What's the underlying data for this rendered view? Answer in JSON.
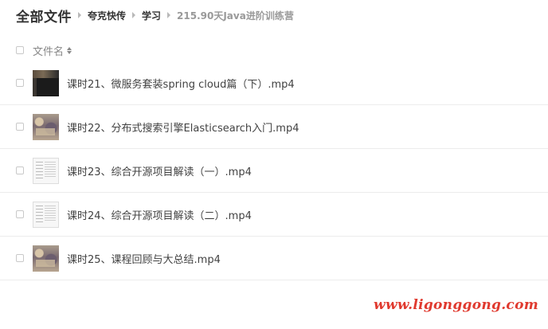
{
  "breadcrumb": {
    "root": "全部文件",
    "items": [
      "夸克快传",
      "学习",
      "215.90天Java进阶训练营"
    ]
  },
  "header": {
    "column_label": "文件名"
  },
  "files": [
    {
      "name": "课时21、微服务套装spring cloud篇（下）.mp4",
      "thumb": "video-thumbnail-dark"
    },
    {
      "name": "课时22、分布式搜索引擎Elasticsearch入门.mp4",
      "thumb": "video-thumbnail-photo"
    },
    {
      "name": "课时23、综合开源项目解读（一）.mp4",
      "thumb": "video-thumbnail-document"
    },
    {
      "name": "课时24、综合开源项目解读（二）.mp4",
      "thumb": "video-thumbnail-document"
    },
    {
      "name": "课时25、课程回顾与大总结.mp4",
      "thumb": "video-thumbnail-photo"
    }
  ],
  "watermark": "www.ligonggong.com"
}
